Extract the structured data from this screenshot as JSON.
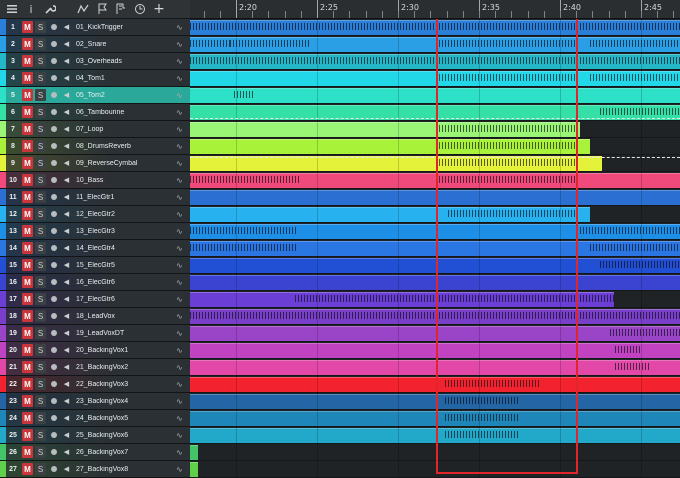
{
  "toolbar": {
    "icons": [
      "list-icon",
      "info-icon",
      "wrench-icon",
      "automation-icon",
      "flag-icon",
      "marker-icon",
      "clock-icon",
      "add-icon"
    ],
    "info_glyph": "i",
    "add_glyph": "+"
  },
  "ruler": {
    "labels": [
      "2:20",
      "2:25",
      "2:30",
      "2:35",
      "2:40",
      "2:45"
    ]
  },
  "buttons": {
    "mute": "M",
    "solo": "S"
  },
  "tracks": [
    {
      "num": "1",
      "name": "01_KickTrigger",
      "color": "#2a7fd8",
      "strip": "#2a7fd8",
      "sel": false
    },
    {
      "num": "2",
      "name": "02_Snare",
      "color": "#2a9fe6",
      "strip": "#2a9fe6",
      "sel": false
    },
    {
      "num": "3",
      "name": "03_Overheads",
      "color": "#23b7c7",
      "strip": "#23b7c7",
      "sel": false
    },
    {
      "num": "4",
      "name": "04_Tom1",
      "color": "#22d8e8",
      "strip": "#22d8e8",
      "sel": false
    },
    {
      "num": "5",
      "name": "05_Tom2",
      "color": "#2de1c9",
      "strip": "#2de1c9",
      "sel": true
    },
    {
      "num": "6",
      "name": "06_Tambourine",
      "color": "#35e0a7",
      "strip": "#35e0a7",
      "sel": false
    },
    {
      "num": "7",
      "name": "07_Loop",
      "color": "#9af577",
      "strip": "#9af577",
      "sel": false
    },
    {
      "num": "8",
      "name": "08_DrumsReverb",
      "color": "#a8f23a",
      "strip": "#a8f23a",
      "sel": false
    },
    {
      "num": "9",
      "name": "09_ReverseCymbal",
      "color": "#e4f23a",
      "strip": "#e4f23a",
      "sel": false
    },
    {
      "num": "10",
      "name": "10_Bass",
      "color": "#f04a7c",
      "strip": "#f04a7c",
      "sel": false
    },
    {
      "num": "11",
      "name": "11_ElecGtr1",
      "color": "#2b6fd2",
      "strip": "#2b6fd2",
      "sel": false
    },
    {
      "num": "12",
      "name": "12_ElecGtr2",
      "color": "#27b1ee",
      "strip": "#27b1ee",
      "sel": false
    },
    {
      "num": "13",
      "name": "13_ElecGtr3",
      "color": "#1d8fe6",
      "strip": "#1d8fe6",
      "sel": false
    },
    {
      "num": "14",
      "name": "14_ElecGtr4",
      "color": "#2a76e3",
      "strip": "#2a76e3",
      "sel": false
    },
    {
      "num": "15",
      "name": "15_ElecGtr5",
      "color": "#2250d4",
      "strip": "#2250d4",
      "sel": false
    },
    {
      "num": "16",
      "name": "16_ElecGtr6",
      "color": "#3b44d0",
      "strip": "#3b44d0",
      "sel": false
    },
    {
      "num": "17",
      "name": "17_ElecGtr6",
      "color": "#6b3ed6",
      "strip": "#6b3ed6",
      "sel": false
    },
    {
      "num": "18",
      "name": "18_LeadVox",
      "color": "#7a3fc9",
      "strip": "#7a3fc9",
      "sel": false
    },
    {
      "num": "19",
      "name": "19_LeadVoxDT",
      "color": "#9a44c7",
      "strip": "#9a44c7",
      "sel": false
    },
    {
      "num": "20",
      "name": "20_BackingVox1",
      "color": "#c243c2",
      "strip": "#c243c2",
      "sel": false
    },
    {
      "num": "21",
      "name": "21_BackingVox2",
      "color": "#e148a7",
      "strip": "#e148a7",
      "sel": false
    },
    {
      "num": "22",
      "name": "22_BackingVox3",
      "color": "#f2222f",
      "strip": "#f2222f",
      "sel": false
    },
    {
      "num": "23",
      "name": "23_BackingVox4",
      "color": "#2465a6",
      "strip": "#2465a6",
      "sel": false
    },
    {
      "num": "24",
      "name": "24_BackingVox5",
      "color": "#1f86b9",
      "strip": "#1f86b9",
      "sel": false
    },
    {
      "num": "25",
      "name": "25_BackingVox6",
      "color": "#22a8c8",
      "strip": "#22a8c8",
      "sel": false
    },
    {
      "num": "26",
      "name": "26_BackingVox7",
      "color": "#43c466",
      "strip": "#43c466",
      "sel": false
    },
    {
      "num": "27",
      "name": "27_BackingVox8",
      "color": "#5fd04a",
      "strip": "#5fd04a",
      "sel": false
    }
  ],
  "colors": {
    "selection": "#e0262b",
    "mute": "#c8353a"
  }
}
